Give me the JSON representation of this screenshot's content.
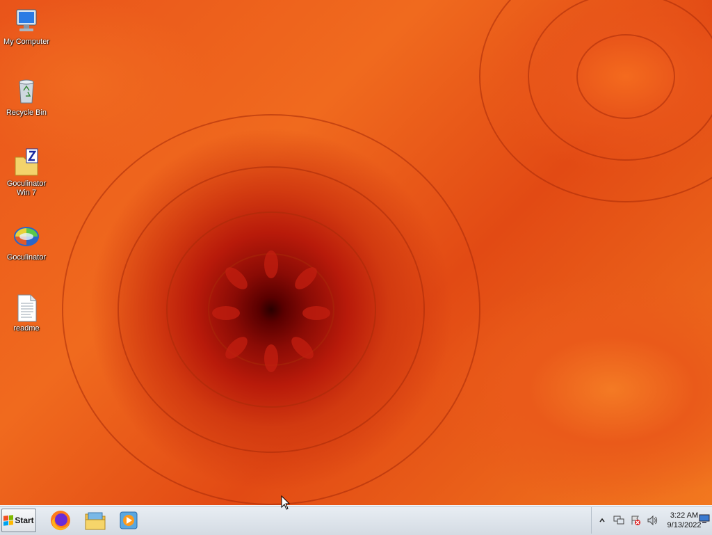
{
  "desktop": {
    "icons": [
      {
        "label": "My Computer",
        "icon": "computer-icon"
      },
      {
        "label": "Recycle Bin",
        "icon": "recycle-bin-icon"
      },
      {
        "label": "Goculinator\nWin 7",
        "icon": "zip-folder-icon"
      },
      {
        "label": "Goculinator",
        "icon": "app-orb-icon"
      },
      {
        "label": "readme",
        "icon": "text-document-icon"
      }
    ]
  },
  "taskbar": {
    "start_label": "Start",
    "pinned": [
      {
        "icon": "firefox-icon"
      },
      {
        "icon": "file-explorer-icon"
      },
      {
        "icon": "media-player-icon"
      }
    ]
  },
  "tray": {
    "icons": [
      "show-hidden-icons-chevron",
      "network-icon",
      "action-center-icon",
      "volume-icon"
    ],
    "time": "3:22 AM",
    "date": "9/13/2022"
  },
  "colors": {
    "wallpaper_primary": "#e9541a",
    "wallpaper_center": "#5a0000",
    "taskbar_bg": "#dfe5ec"
  }
}
